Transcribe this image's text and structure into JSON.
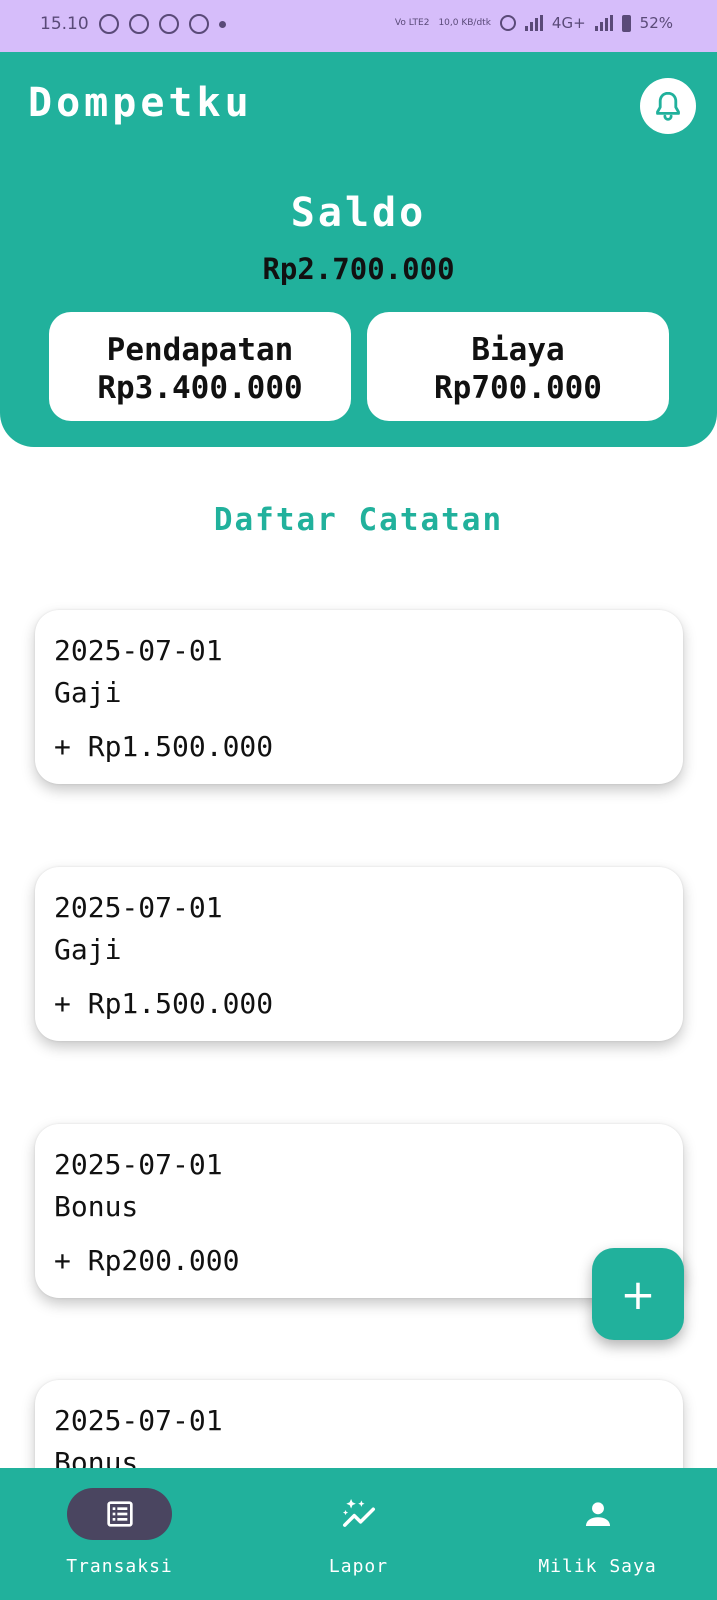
{
  "status_bar": {
    "time": "15.10",
    "network_label": "Vo LTE2",
    "speed": "10,0 KB/dtk",
    "signal_type": "4G+",
    "battery": "52%"
  },
  "header": {
    "app_title": "Dompetku",
    "bell_icon": "bell-icon",
    "balance_label": "Saldo",
    "balance_value": "Rp2.700.000",
    "income_label": "Pendapatan",
    "income_value": "Rp3.400.000",
    "expense_label": "Biaya",
    "expense_value": "Rp700.000"
  },
  "list": {
    "title": "Daftar Catatan",
    "items": [
      {
        "date": "2025-07-01",
        "category": "Gaji",
        "amount": "+ Rp1.500.000"
      },
      {
        "date": "2025-07-01",
        "category": "Gaji",
        "amount": "+ Rp1.500.000"
      },
      {
        "date": "2025-07-01",
        "category": "Bonus",
        "amount": "+ Rp200.000"
      },
      {
        "date": "2025-07-01",
        "category": "Bonus",
        "amount": ""
      }
    ]
  },
  "fab": {
    "label": "+",
    "icon": "plus-icon"
  },
  "bottom_nav": {
    "items": [
      {
        "label": "Transaksi",
        "icon": "list-icon",
        "active": true
      },
      {
        "label": "Lapor",
        "icon": "chart-sparkle-icon",
        "active": false
      },
      {
        "label": "Milik Saya",
        "icon": "person-icon",
        "active": false
      }
    ]
  },
  "colors": {
    "primary": "#21b19c",
    "status_bar": "#d6bdfa",
    "active_pill": "#4a4560"
  }
}
